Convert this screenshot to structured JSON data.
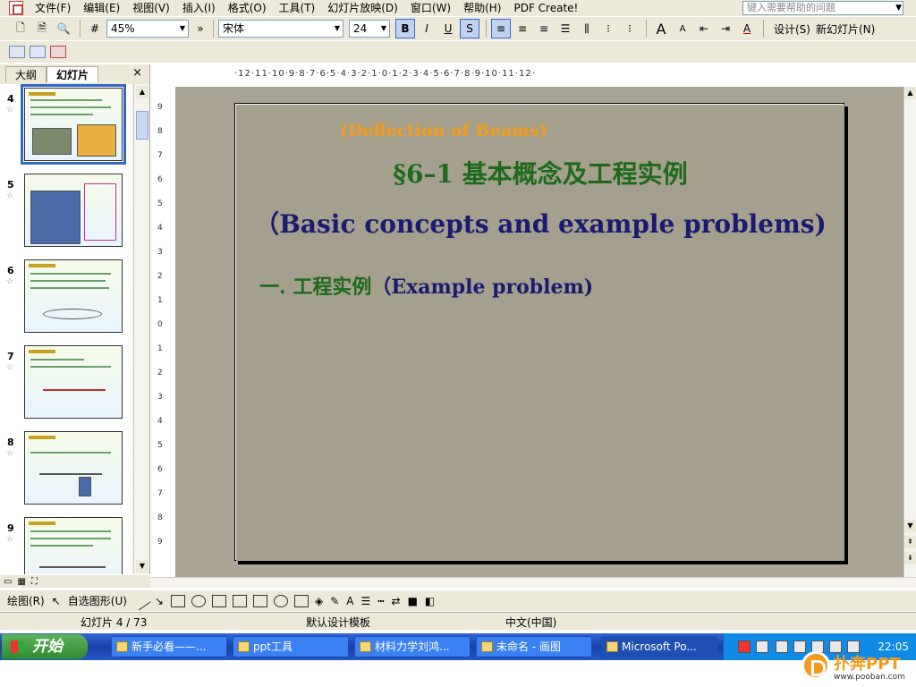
{
  "menubar": {
    "items": [
      "文件(F)",
      "编辑(E)",
      "视图(V)",
      "插入(I)",
      "格式(O)",
      "工具(T)",
      "幻灯片放映(D)",
      "窗口(W)",
      "帮助(H)",
      "PDF Create!"
    ],
    "help_placeholder": "键入需要帮助的问题"
  },
  "toolbar1": {
    "zoom": "45%",
    "font": "宋体",
    "font_size": "24",
    "design_label": "设计(S)",
    "new_slide_label": "新幻灯片(N)"
  },
  "left_pane": {
    "tabs": [
      "大纲",
      "幻灯片"
    ],
    "active_tab": "幻灯片",
    "close": "×",
    "slides": [
      {
        "num": "4",
        "selected": true
      },
      {
        "num": "5",
        "selected": false
      },
      {
        "num": "6",
        "selected": false
      },
      {
        "num": "7",
        "selected": false
      },
      {
        "num": "8",
        "selected": false
      },
      {
        "num": "9",
        "selected": false
      }
    ]
  },
  "ruler": {
    "h_text": "·12·11·10·9·8·7·6·5·4·3·2·1·0·1·2·3·4·5·6·7·8·9·10·11·12·",
    "v_ticks": [
      "9",
      "8",
      "7",
      "6",
      "5",
      "4",
      "3",
      "2",
      "1",
      "0",
      "1",
      "2",
      "3",
      "4",
      "5",
      "6",
      "7",
      "8",
      "9"
    ]
  },
  "slide": {
    "subtitle": "(Deflection of Beams)",
    "title_cn": "§6–1  基本概念及工程实例",
    "title_en": "（Basic concepts and example problems)",
    "item_cn": "一.  工程实例",
    "item_en": "（Example problem)"
  },
  "drawbar": {
    "draw_label": "绘图(R)",
    "autoshape_label": "自选图形(U)"
  },
  "statusbar": {
    "slide_pos": "幻灯片 4 / 73",
    "template": "默认设计模板",
    "language": "中文(中国)"
  },
  "taskbar": {
    "start": "开始",
    "tasks": [
      "新手必看——...",
      "ppt工具",
      "材料力学刘鸿...",
      "未命名 - 画图",
      "Microsoft Po..."
    ],
    "clock": "22:05"
  },
  "watermark": {
    "text": "扑奔PPT",
    "url": "www.pooban.com"
  },
  "colors": {
    "slide_bg": "#a59f8e",
    "subtitle": "#f39a1c",
    "title_cn": "#1d6a1d",
    "title_en": "#1a1a70",
    "selection": "#316ac5"
  }
}
